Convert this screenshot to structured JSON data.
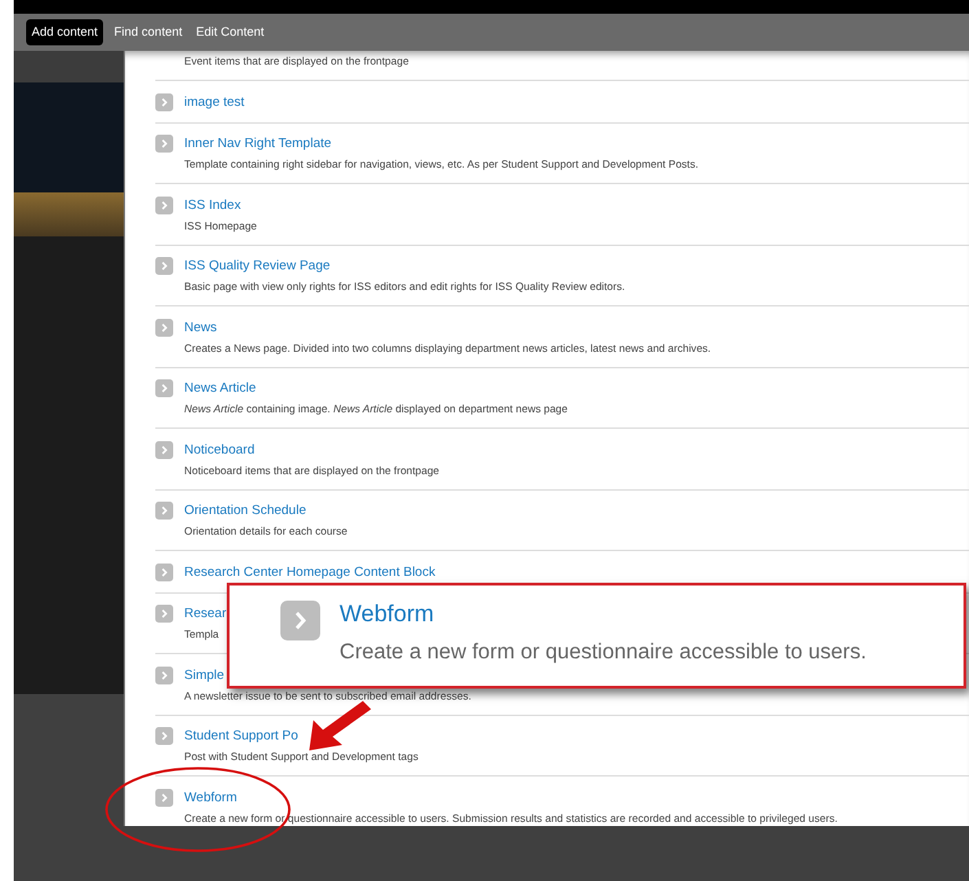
{
  "toolbar": [
    {
      "label": "Add content",
      "selected": true
    },
    {
      "label": "Find content",
      "selected": false
    },
    {
      "label": "Edit Content",
      "selected": false
    }
  ],
  "content_types": [
    {
      "description": "Event items that are displayed on the frontpage"
    },
    {
      "title": "image test"
    },
    {
      "title": "Inner Nav Right Template",
      "description": "Template containing right sidebar for navigation, views, etc. As per Student Support and Development Posts."
    },
    {
      "title": "ISS Index",
      "description": "ISS Homepage"
    },
    {
      "title": "ISS Quality Review Page",
      "description": "Basic page with view only rights for ISS editors and edit rights for ISS Quality Review editors."
    },
    {
      "title": "News",
      "description": "Creates a News page. Divided into two columns displaying department news articles, latest news and archives."
    },
    {
      "title": "News Article",
      "description": "*News Article* containing image. *News Article* displayed on department news page"
    },
    {
      "title": "Noticeboard",
      "description": "Noticeboard items that are displayed on the frontpage"
    },
    {
      "title": "Orientation Schedule",
      "description": "Orientation details for each course"
    },
    {
      "title": "Research Center Homepage Content Block"
    },
    {
      "title": "Resear",
      "description": "Templa"
    },
    {
      "title": "Simple",
      "description": "A newsletter issue to be sent to subscribed email addresses."
    },
    {
      "title": "Student Support Po",
      "description": "Post with Student Support and Development tags"
    },
    {
      "title": "Webform",
      "description": "Create a new form or questionnaire accessible to users. Submission results and statistics are recorded and accessible to privileged users."
    }
  ],
  "callout": {
    "title": "Webform",
    "description": "Create a new form or questionnaire accessible to users."
  }
}
